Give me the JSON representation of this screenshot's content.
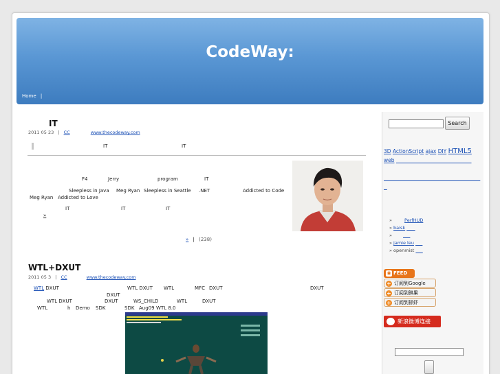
{
  "header": {
    "title": "CodeWay:",
    "nav_home": "Home",
    "nav_sep": "|"
  },
  "post1": {
    "title": "IT",
    "date": "2011 05 23",
    "sep": "|",
    "author_link": "CC",
    "site_link": "www.thecodeway.com",
    "crumb_it_1": "IT",
    "crumb_it_2": "IT",
    "body": {
      "l1_a": "F4",
      "l1_b": "Jerry",
      "l1_c": "program",
      "l1_d": "IT",
      "l2_a": "Sleepless in Java",
      "l2_b": "Meg Ryan",
      "l2_c": "Sleepless in Seattle",
      "l2_d": ".NET",
      "l2_e": "Addicted to Code",
      "l3_a": "Meg Ryan",
      "l3_b": "Addicted to Love",
      "l4_a": "IT",
      "l4_b": "IT",
      "l4_c": "IT",
      "more": "»",
      "comments_more": "»",
      "comments_sep": "|",
      "comments_count": "(238)"
    }
  },
  "post2": {
    "title": "WTL+DXUT",
    "date": "2011 05 3",
    "sep": "|",
    "author_link": "CC",
    "site_link": "www.thecodeway.com",
    "body": {
      "l1_wtl": "WTL",
      "l1_dxut": "DXUT",
      "l1_c": "WTL DXUT",
      "l1_d": "WTL",
      "l1_e": "MFC",
      "l1_f": "DXUT",
      "l1_g": "DXUT",
      "l2_a": "DXUT",
      "l3_a": "WTL DXUT",
      "l3_b": "DXUT",
      "l3_c": "WS_CHILD",
      "l3_d": "WTL",
      "l3_e": "DXUT",
      "l4_a": "WTL",
      "l4_b": "h",
      "l4_c": "Demo",
      "l4_d": "SDK",
      "l4_e": "SDK",
      "l4_f": "Aug09",
      "l4_g": "WTL 8.0"
    }
  },
  "sidebar": {
    "search_button": "Search",
    "tags": [
      "3D",
      "ActionScript",
      "ajax",
      "DIY",
      "HTML5",
      "web"
    ],
    "friends": [
      "PerfHUD",
      "baisk",
      "",
      "jamie leu",
      "openmist"
    ],
    "feed_label": "FEED",
    "subscribe_google": "订阅到Google",
    "subscribe_xianguo": "订阅到鲜果",
    "subscribe_zhuaxia": "订阅到抓虾",
    "weibo_label": "新浪微博连接"
  },
  "colors": {
    "header_top": "#7fb3e4",
    "header_bottom": "#3d7cbf",
    "link": "#1a4fb5",
    "feed": "#e8751a",
    "weibo": "#d52b1e"
  }
}
